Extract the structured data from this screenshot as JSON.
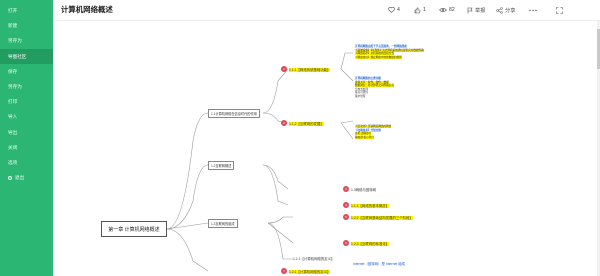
{
  "sidebar": {
    "items": [
      {
        "label": "打开",
        "active": false
      },
      {
        "label": "新建",
        "active": false
      },
      {
        "label": "另存为",
        "active": false
      },
      {
        "label": "导图社区",
        "active": true
      },
      {
        "label": "保存",
        "active": false
      },
      {
        "label": "另存为",
        "active": false
      },
      {
        "label": "打印",
        "active": false
      },
      {
        "label": "导入",
        "active": false
      },
      {
        "label": "导出",
        "active": false
      },
      {
        "label": "关闭",
        "active": false
      },
      {
        "label": "选项",
        "active": false
      }
    ],
    "exit_label": "退出"
  },
  "header": {
    "title": "计算机网络概述",
    "like_count": "4",
    "thumb_count": "1",
    "view_count": "82",
    "report_label": "举报",
    "share_label": "分享"
  },
  "map": {
    "root": "第一章 计算机网络概述",
    "branches": [
      "1.1计算机网络在信息时代的作用",
      "1.2互联网概述",
      "1.3互联网的组成"
    ],
    "nodes": [
      {
        "badge": "1",
        "label": "1.1.1【网络系统基础功能】"
      },
      {
        "badge": "2",
        "label": "1.1.2【互联网的发展】"
      },
      {
        "badge": "3",
        "label": "1.3网络与因特网"
      },
      {
        "badge": "4",
        "label": "1.1.1【网络的基本概念】"
      },
      {
        "badge": "5",
        "label": "1.2.2【互联网基础结构发展的三个阶段】"
      },
      {
        "badge": "6",
        "label": "1.2.3【互联网的标准化】"
      },
      {
        "badge": "7",
        "label": "1.2.1【计算机网络的定义】"
      }
    ],
    "sub_label": "1.1.1【计算机网络的定义】",
    "internet_note": "Internet（因特网）是 Internet 组成",
    "text_lines": [
      "计算机网络由若干节点连接的，一些网络组成",
      "【基础设施】【可靠性】为计算机系统通信提供实时数据传输",
      "【网络拓扑】主机系统的连接方式",
      "【网络协议】规定网络中交换数据的规则",
      "计算机网络的主要功能",
      "资源共享：软件、硬件、数据",
      "数据通信：各计算机之间传输信息",
      "分布式处理",
      "提高可靠性",
      "集中管理",
      "【层次化】互联网是网络的网络",
      "【交换技术】分组交换",
      "主机 边缘部分",
      "路由器 核心部分"
    ]
  }
}
